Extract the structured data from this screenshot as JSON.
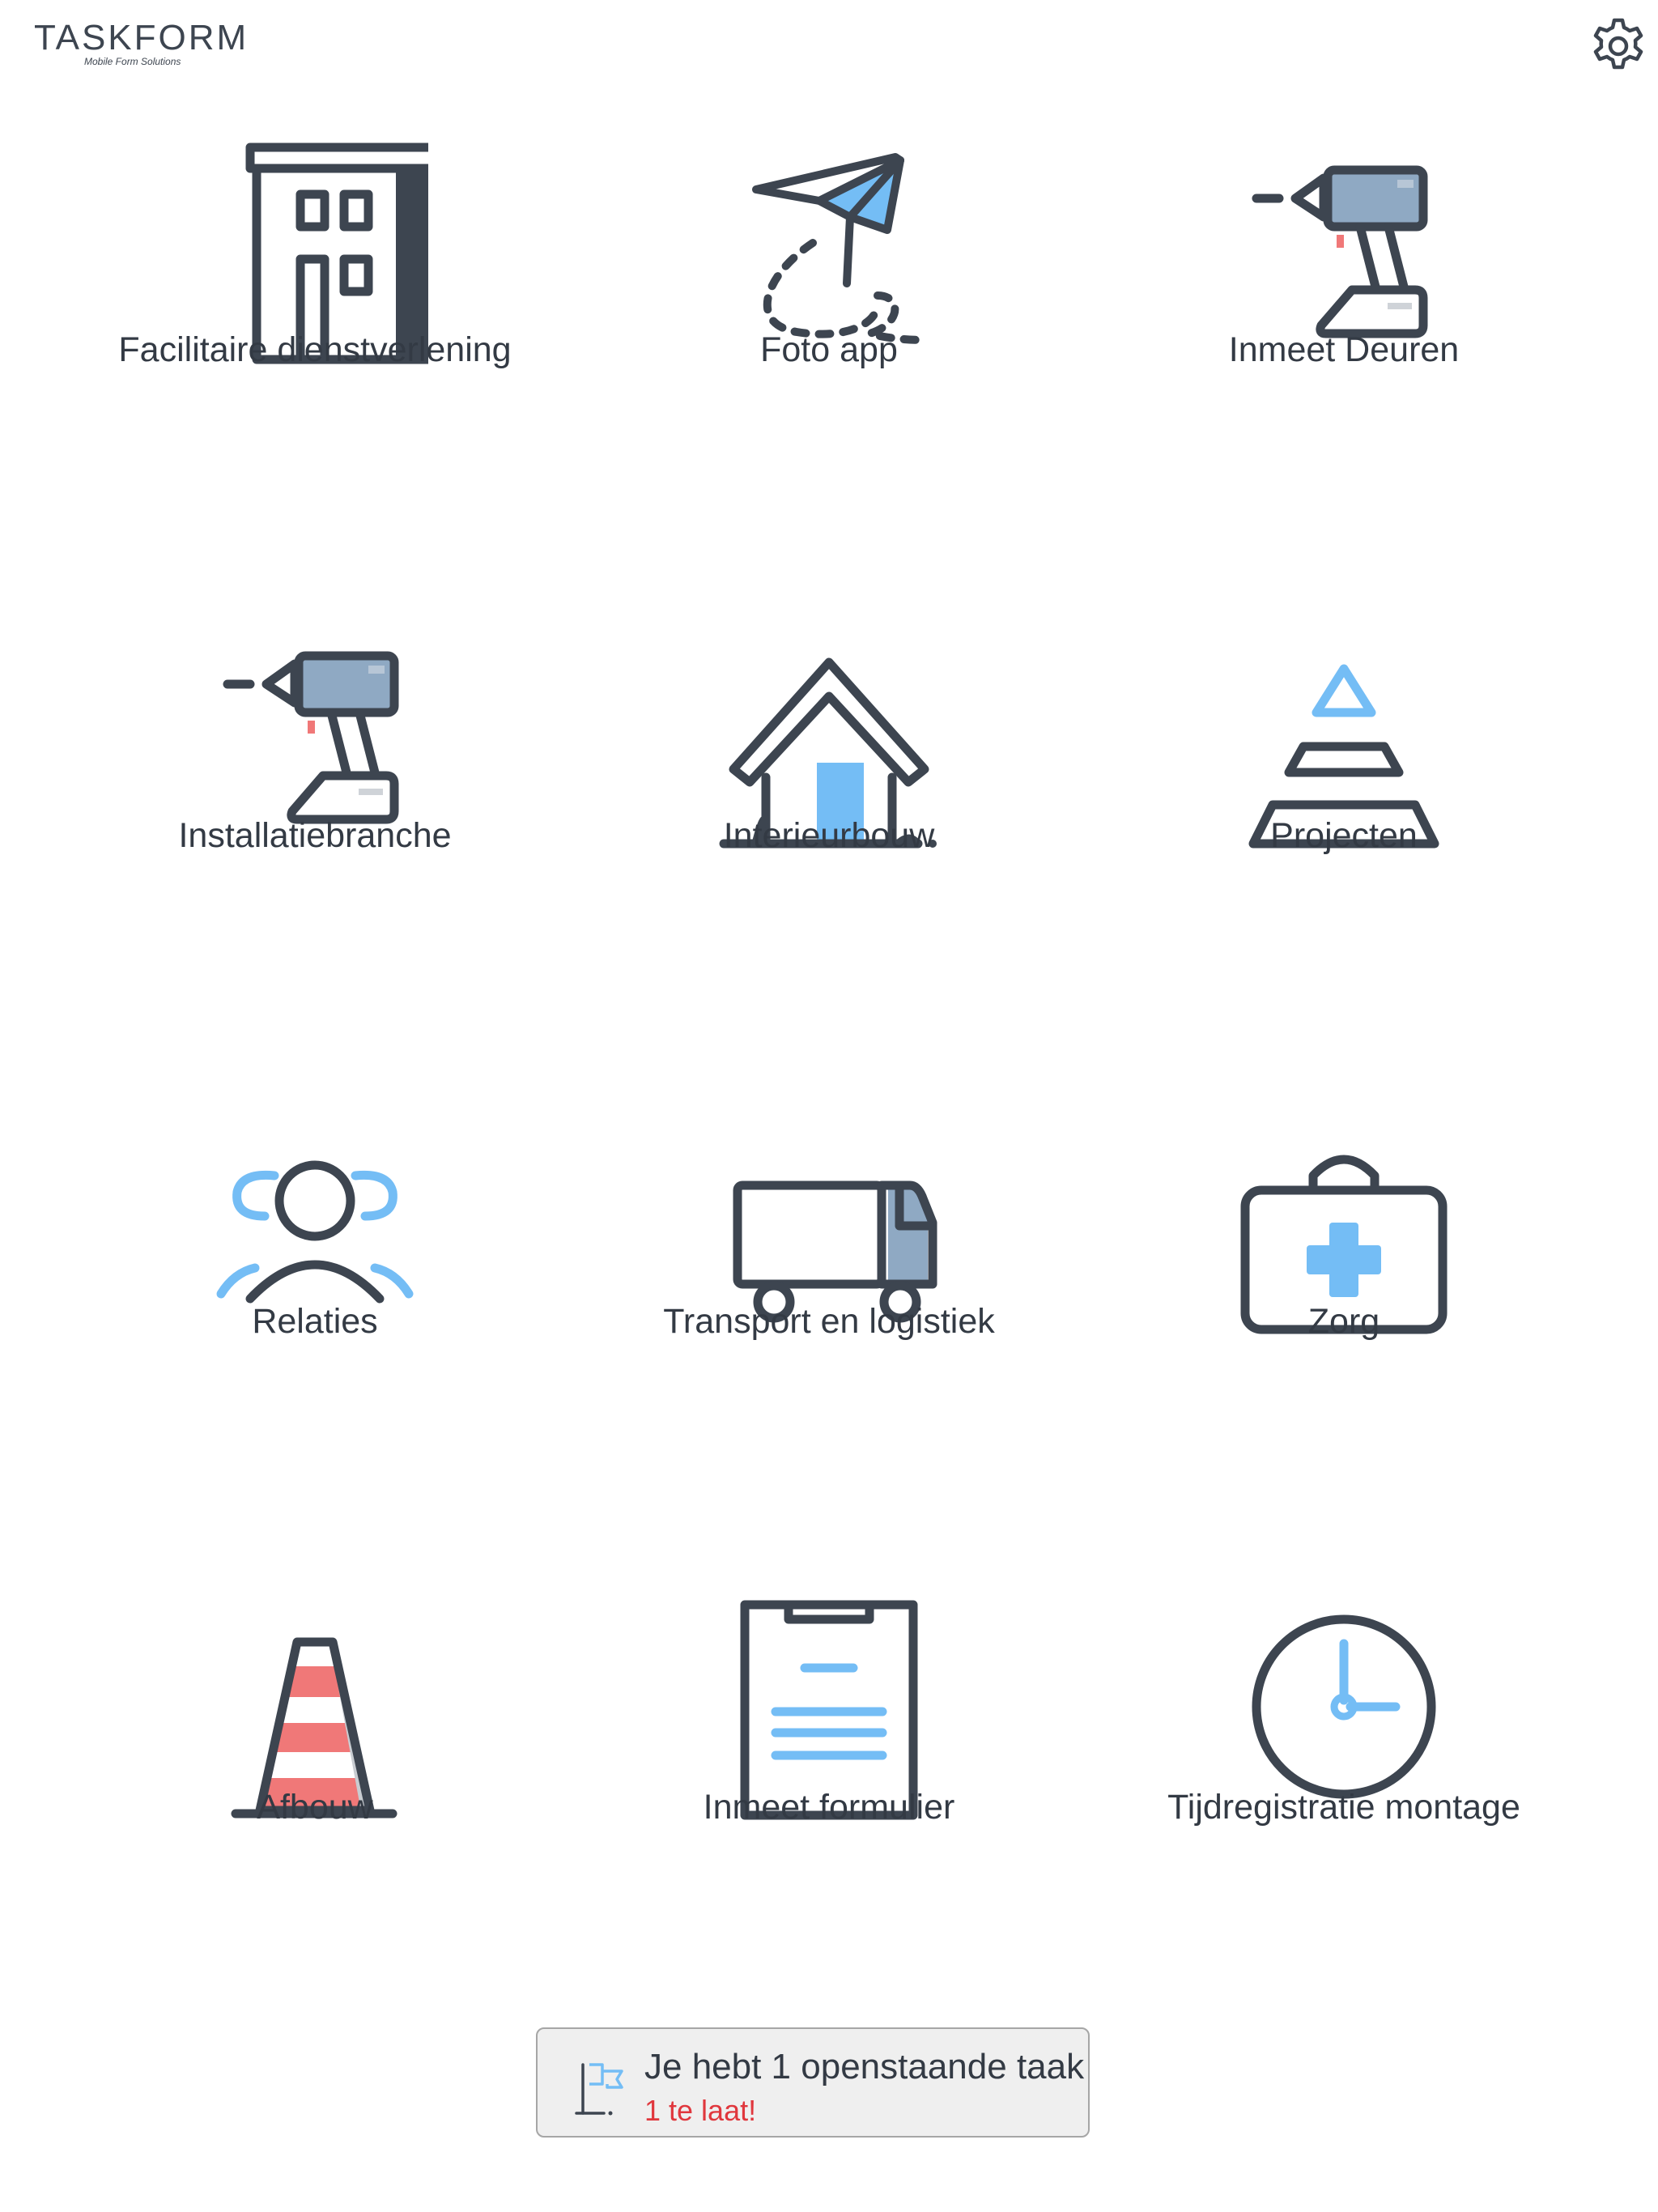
{
  "header": {
    "logo_text": "TASKFORM",
    "logo_tagline": "Mobile Form Solutions",
    "settings_icon": "gear-icon"
  },
  "colors": {
    "icon_dark": "#3d4550",
    "icon_blue": "#74bdf5",
    "icon_steel": "#8fa9c3",
    "accent_red": "#f07878",
    "late_text": "#e0373d"
  },
  "tiles": [
    {
      "label": "Facilitaire dienstverlening",
      "icon": "building-icon"
    },
    {
      "label": "Foto app",
      "icon": "paper-plane-icon"
    },
    {
      "label": "Inmeet Deuren",
      "icon": "drill-icon"
    },
    {
      "label": "Installatiebranche",
      "icon": "drill-icon"
    },
    {
      "label": "Interieurbouw",
      "icon": "house-icon"
    },
    {
      "label": "Projecten",
      "icon": "pyramid-icon"
    },
    {
      "label": "Relaties",
      "icon": "people-icon"
    },
    {
      "label": "Transport en logistiek",
      "icon": "truck-icon"
    },
    {
      "label": "Zorg",
      "icon": "medical-kit-icon"
    },
    {
      "label": "Afbouw",
      "icon": "traffic-cone-icon"
    },
    {
      "label": "Inmeet formulier",
      "icon": "clipboard-icon"
    },
    {
      "label": "Tijdregistratie montage",
      "icon": "clock-icon"
    }
  ],
  "notification": {
    "title": "Je hebt 1 openstaande taak",
    "subtitle": "1 te laat!",
    "icon": "flag-icon"
  }
}
